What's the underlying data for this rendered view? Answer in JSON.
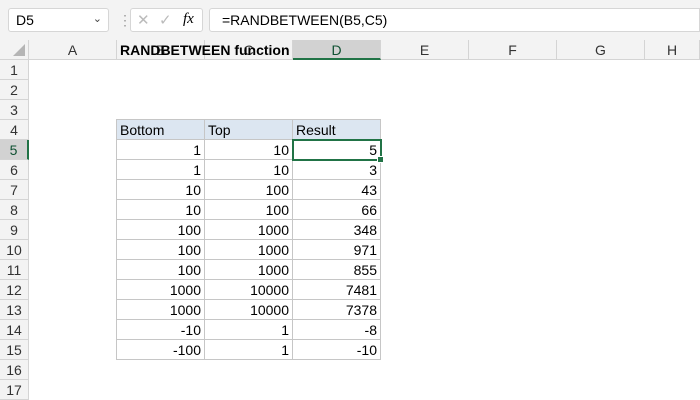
{
  "name_box": "D5",
  "formula": "=RANDBETWEEN(B5,C5)",
  "icons": {
    "cancel": "✕",
    "enter": "✓",
    "fx": "fx"
  },
  "columns": [
    "A",
    "B",
    "C",
    "D",
    "E",
    "F",
    "G",
    "H"
  ],
  "selected_column": "D",
  "selected_row": 5,
  "rows": [
    "1",
    "2",
    "3",
    "4",
    "5",
    "6",
    "7",
    "8",
    "9",
    "10",
    "11",
    "12",
    "13",
    "14",
    "15",
    "16",
    "17"
  ],
  "title": "RANDBETWEEN function",
  "table": {
    "headers": [
      "Bottom",
      "Top",
      "Result"
    ],
    "rows": [
      [
        "1",
        "10",
        "5"
      ],
      [
        "1",
        "10",
        "3"
      ],
      [
        "10",
        "100",
        "43"
      ],
      [
        "10",
        "100",
        "66"
      ],
      [
        "100",
        "1000",
        "348"
      ],
      [
        "100",
        "1000",
        "971"
      ],
      [
        "100",
        "1000",
        "855"
      ],
      [
        "1000",
        "10000",
        "7481"
      ],
      [
        "1000",
        "10000",
        "7378"
      ],
      [
        "-10",
        "1",
        "-8"
      ],
      [
        "-100",
        "1",
        "-10"
      ]
    ]
  }
}
